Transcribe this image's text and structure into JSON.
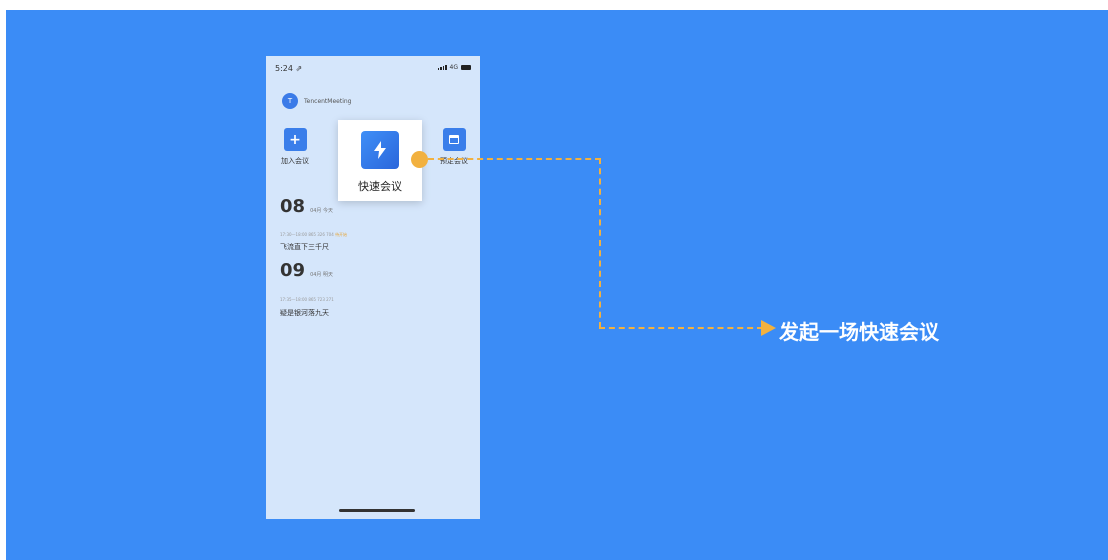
{
  "status_bar": {
    "time": "5:24 ⇗",
    "network": "4G"
  },
  "account": {
    "avatar_letter": "T",
    "name": "TencentMeeting"
  },
  "actions": {
    "join_label": "加入会议",
    "quick_label": "快速会议",
    "schedule_label": "预定会议"
  },
  "schedule": [
    {
      "day": "08",
      "subtitle": "04月 今天",
      "meta": "17:30—18:00  865 326 704",
      "tag": "待开始",
      "title": "飞流直下三千尺"
    },
    {
      "day": "09",
      "subtitle": "04月 明天",
      "meta": "17:35—18:00  865 723 271",
      "tag": "",
      "title": "疑是银河落九天"
    }
  ],
  "callout": {
    "text": "发起一场快速会议"
  },
  "colors": {
    "background": "#3b8cf6",
    "accent": "#f2b13f",
    "phone": "#d5e6fb"
  }
}
